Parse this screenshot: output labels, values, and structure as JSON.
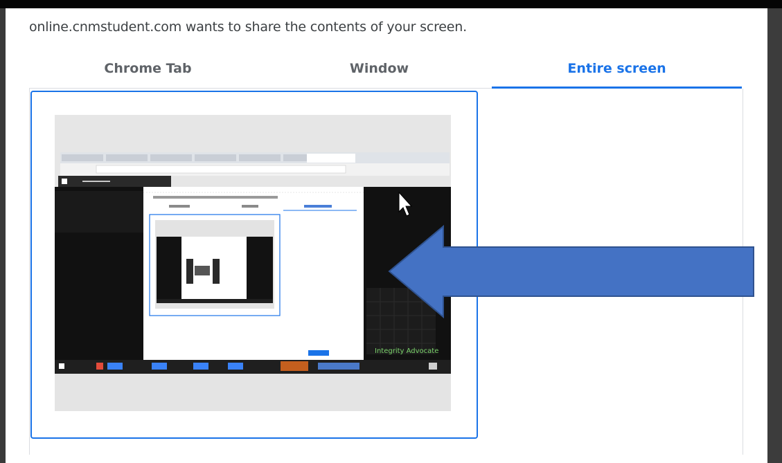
{
  "dialog": {
    "prompt": "online.cnmstudent.com wants to share the contents of your screen.",
    "tabs": [
      {
        "label": "Chrome Tab",
        "active": false
      },
      {
        "label": "Window",
        "active": false
      },
      {
        "label": "Entire screen",
        "active": true
      }
    ]
  },
  "thumbnail": {
    "inner_tabs": [
      "Chrome Tab",
      "Window",
      "Entire screen"
    ],
    "watermark": "Integrity Advocate"
  },
  "colors": {
    "accent": "#1a73e8",
    "arrow_fill": "#4472c4",
    "arrow_stroke": "#2f528f"
  },
  "icons": [
    "cursor-icon",
    "left-arrow-annotation-icon"
  ]
}
